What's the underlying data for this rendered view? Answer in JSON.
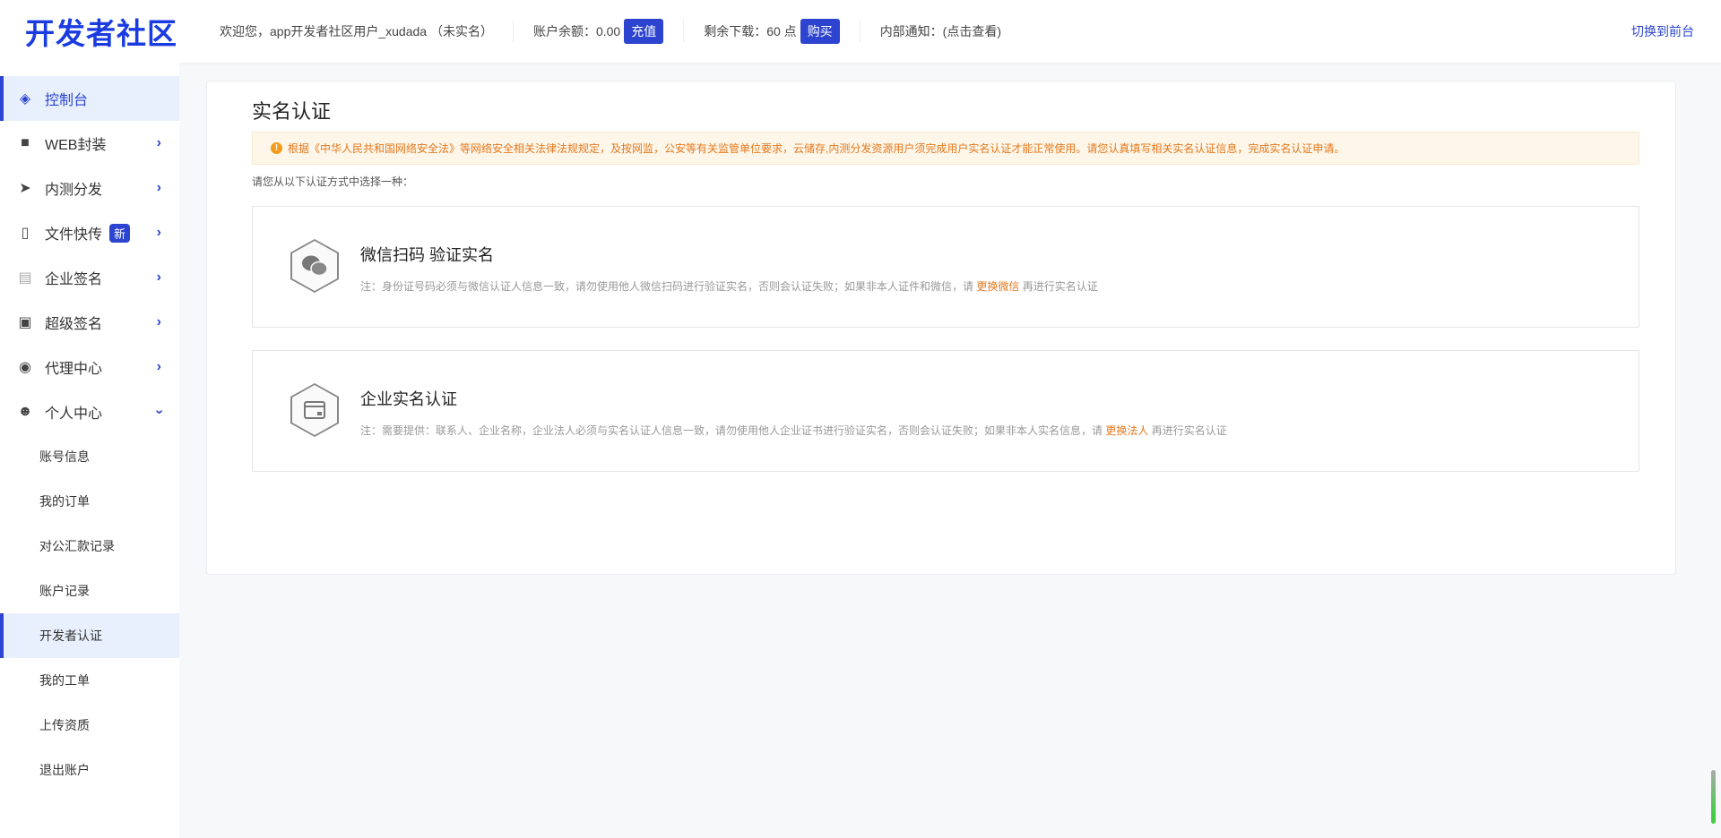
{
  "header": {
    "logo": "开发者社区",
    "welcome": "欢迎您，app开发者社区用户_xudada （未实名）",
    "balance_label": "账户余额：0.00",
    "recharge": "充值",
    "downloads_label": "剩余下载：60 点",
    "buy": "购买",
    "notice": "内部通知：(点击查看)",
    "switch": "切换到前台"
  },
  "sidebar": {
    "items": [
      {
        "label": "控制台",
        "icon": "layers-icon"
      },
      {
        "label": "WEB封装",
        "icon": "box-icon"
      },
      {
        "label": "内测分发",
        "icon": "paper-plane-icon"
      },
      {
        "label": "文件快传",
        "icon": "file-icon",
        "badge": "新"
      },
      {
        "label": "企业签名",
        "icon": "clipboard-icon"
      },
      {
        "label": "超级签名",
        "icon": "certificate-icon"
      },
      {
        "label": "代理中心",
        "icon": "agent-icon"
      },
      {
        "label": "个人中心",
        "icon": "user-icon"
      }
    ],
    "subitems": [
      "账号信息",
      "我的订单",
      "对公汇款记录",
      "账户记录",
      "开发者认证",
      "我的工单",
      "上传资质",
      "退出账户"
    ]
  },
  "main": {
    "title": "实名认证",
    "notice": "根据《中华人民共和国网络安全法》等网络安全相关法律法规规定，及按网监，公安等有关监管单位要求，云储存,内测分发资源用户须完成用户实名认证才能正常使用。请您认真填写相关实名认证信息，完成实名认证申请。",
    "hint": "请您从以下认证方式中选择一种：",
    "options": [
      {
        "title": "微信扫码 验证实名",
        "note": "注：身份证号码必须与微信认证人信息一致，请勿使用他人微信扫码进行验证实名，否则会认证失败；如果非本人证件和微信，请",
        "link": "更换微信",
        "tail": "再进行实名认证"
      },
      {
        "title": "企业实名认证",
        "note": "注：需要提供：联系人、企业名称，企业法人必须与实名认证人信息一致，请勿使用他人企业证书进行验证实名，否则会认证失败；如果非本人实名信息，请",
        "link": "更换法人",
        "tail": "再进行实名认证"
      }
    ]
  }
}
